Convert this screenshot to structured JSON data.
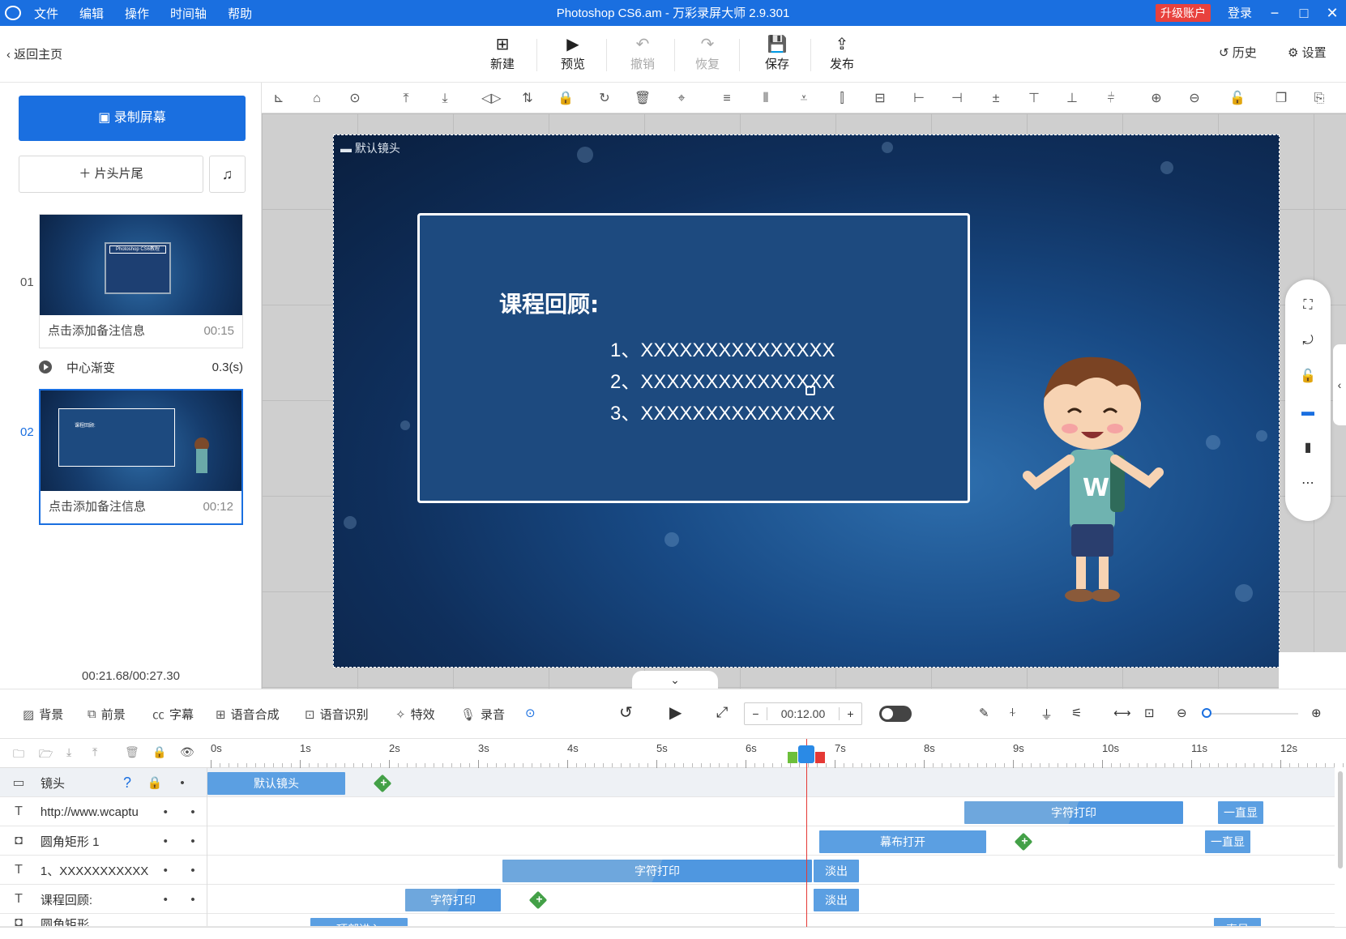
{
  "window": {
    "title": "Photoshop CS6.am - 万彩录屏大师 2.9.301",
    "menu": [
      "文件",
      "编辑",
      "操作",
      "时间轴",
      "帮助"
    ],
    "upgrade_label": "升级账户",
    "login_label": "登录",
    "accent": "#1a6fe0"
  },
  "toolbar": {
    "back_label": "返回主页",
    "buttons": [
      {
        "label": "新建",
        "icon": "plus-square-icon",
        "enabled": true
      },
      {
        "label": "预览",
        "icon": "play-icon",
        "enabled": true
      },
      {
        "label": "撤销",
        "icon": "undo-icon",
        "enabled": false
      },
      {
        "label": "恢复",
        "icon": "redo-icon",
        "enabled": false
      },
      {
        "label": "保存",
        "icon": "save-icon",
        "enabled": true
      },
      {
        "label": "发布",
        "icon": "publish-icon",
        "enabled": true
      }
    ],
    "history_label": "历史",
    "settings_label": "设置"
  },
  "left_panel": {
    "record_label": "录制屏幕",
    "head_tail_label": "片头片尾",
    "scenes": [
      {
        "number": "01",
        "note": "点击添加备注信息",
        "duration": "00:15",
        "selected": false
      },
      {
        "number": "02",
        "note": "点击添加备注信息",
        "duration": "00:12",
        "selected": true
      }
    ],
    "transition": {
      "name": "中心渐变",
      "duration": "0.3(s)"
    },
    "time_counter": "00:21.68/00:27.30"
  },
  "stage": {
    "camera_label": "默认镜头",
    "title": "课程回顾:",
    "lines": [
      "1、XXXXXXXXXXXXXXX",
      "2、XXXXXXXXXXXXXXX",
      "3、XXXXXXXXXXXXXXX"
    ],
    "thumb_title": "Photoshop CS6教程",
    "thumb2_title": "课程回顾:"
  },
  "timeline_toolbar": {
    "items": [
      "背景",
      "前景",
      "字幕",
      "语音合成",
      "语音识别",
      "特效",
      "录音"
    ],
    "current_time": "00:12.00",
    "minus": "−",
    "plus": "+"
  },
  "timeline": {
    "ruler": [
      "0s",
      "1s",
      "2s",
      "3s",
      "4s",
      "5s",
      "6s",
      "7s",
      "8s",
      "9s",
      "10s",
      "11s",
      "12s"
    ],
    "rows": [
      {
        "icon": "camera-icon",
        "name": "镜头",
        "clips": [
          {
            "label": "默认镜头"
          }
        ]
      },
      {
        "icon": "text-icon",
        "name": "http://www.wcaptu",
        "clips": [
          {
            "label": "字符打印"
          },
          {
            "label": "一直显"
          }
        ]
      },
      {
        "icon": "shape-icon",
        "name": "圆角矩形 1",
        "clips": [
          {
            "label": "幕布打开"
          },
          {
            "label": "一直显"
          }
        ]
      },
      {
        "icon": "text-icon",
        "name": "1、XXXXXXXXXXX",
        "clips": [
          {
            "label": "字符打印"
          },
          {
            "label": "淡出"
          }
        ]
      },
      {
        "icon": "text-icon",
        "name": "课程回顾:",
        "clips": [
          {
            "label": "字符打印"
          },
          {
            "label": "淡出"
          }
        ]
      },
      {
        "icon": "shape-icon",
        "name": "圆角矩形",
        "clips": [
          {
            "label": "顶部进入"
          },
          {
            "label": "直显"
          }
        ]
      }
    ]
  }
}
